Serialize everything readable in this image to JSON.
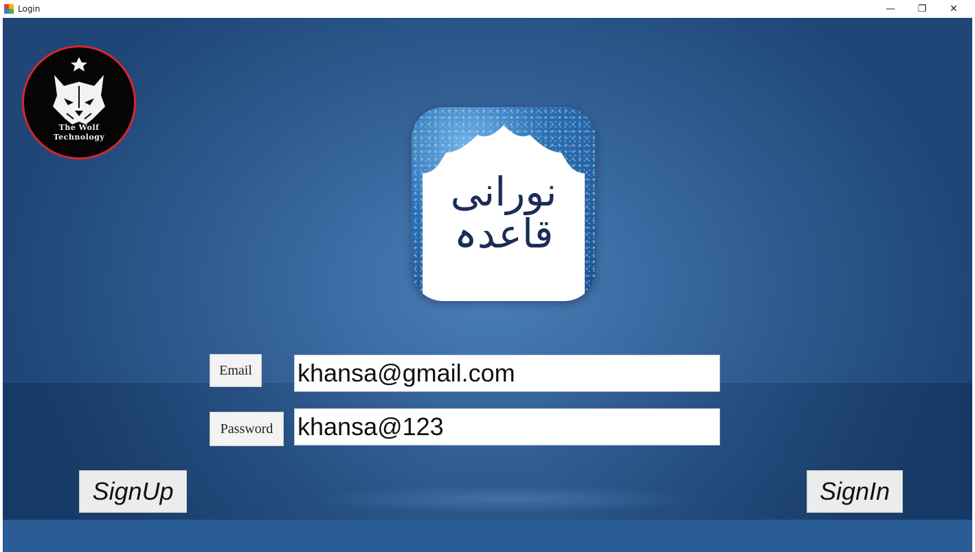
{
  "window": {
    "title": "Login",
    "minimize_glyph": "—",
    "maximize_glyph": "❐",
    "close_glyph": "✕"
  },
  "logo": {
    "line1": "The Wolf",
    "line2": "Technology",
    "icon": "wolf-icon",
    "border_color": "#d8262e"
  },
  "app_tile": {
    "calligraphy": "نورانی قاعدہ",
    "icon": "arabic-calligraphy-icon"
  },
  "form": {
    "email_label": "Email",
    "email_value": "khansa@gmail.com",
    "password_label": "Password",
    "password_value": "khansa@123"
  },
  "buttons": {
    "signup_label": "SignUp",
    "signin_label": "SignIn"
  },
  "colors": {
    "background": "#3a6aa1",
    "accent_red": "#d8262e"
  }
}
